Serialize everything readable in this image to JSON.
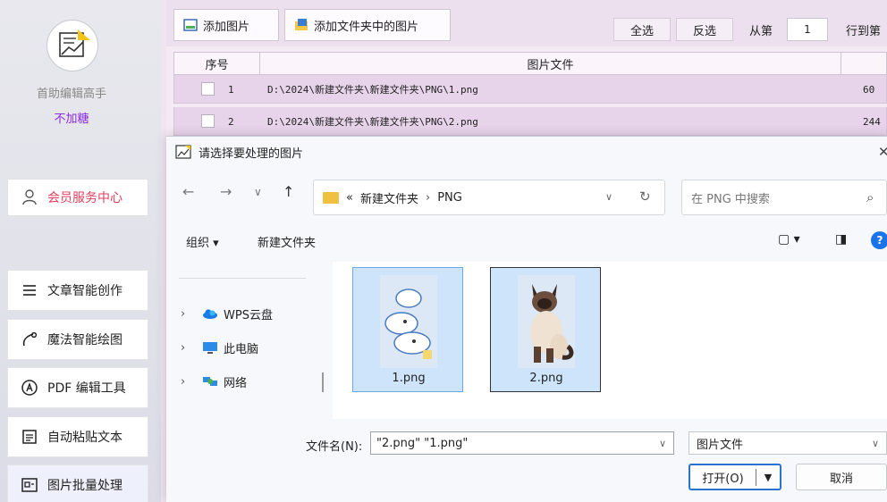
{
  "app": {
    "name": "首助编辑高手",
    "subtitle": "不加糖"
  },
  "sidebar": {
    "member": "会员服务中心",
    "items": [
      {
        "label": "文章智能创作",
        "icon": "list-icon"
      },
      {
        "label": "魔法智能绘图",
        "icon": "wand-icon"
      },
      {
        "label": "PDF 编辑工具",
        "icon": "pdf-icon"
      },
      {
        "label": "自动粘贴文本",
        "icon": "paste-icon"
      },
      {
        "label": "图片批量处理",
        "icon": "image-batch-icon"
      }
    ]
  },
  "toolbar": {
    "add_image": "添加图片",
    "add_folder_images": "添加文件夹中的图片",
    "select_all": "全选",
    "invert": "反选",
    "from_label": "从第",
    "from_value": "1",
    "to_label": "行到第"
  },
  "grid": {
    "columns": [
      "序号",
      "图片文件"
    ],
    "rows": [
      {
        "index": "1",
        "path": "D:\\2024\\新建文件夹\\新建文件夹\\PNG\\1.png",
        "size": "60"
      },
      {
        "index": "2",
        "path": "D:\\2024\\新建文件夹\\新建文件夹\\PNG\\2.png",
        "size": "244"
      }
    ]
  },
  "dialog": {
    "title": "请选择要处理的图片",
    "close": "✕",
    "nav": {
      "back": "←",
      "forward": "→",
      "recent": "∨",
      "up": "↑"
    },
    "address": {
      "prefix": "«",
      "parent": "新建文件夹",
      "sep": "›",
      "current": "PNG"
    },
    "search_placeholder": "在 PNG 中搜索",
    "organize": "组织 ▾",
    "new_folder": "新建文件夹",
    "tree": [
      {
        "label": "WPS云盘",
        "icon": "cloud-icon"
      },
      {
        "label": "此电脑",
        "icon": "computer-icon"
      },
      {
        "label": "网络",
        "icon": "network-icon"
      }
    ],
    "files": [
      {
        "name": "1.png"
      },
      {
        "name": "2.png"
      }
    ],
    "filename_label": "文件名(N):",
    "filename_value": "\"2.png\" \"1.png\"",
    "filetype_value": "图片文件",
    "open_label": "打开(O)",
    "cancel_label": "取消"
  },
  "colors": {
    "accent": "#8a2be2",
    "member_text": "#e0405e",
    "selection": "#cde4fb",
    "help": "#1a73e8"
  }
}
